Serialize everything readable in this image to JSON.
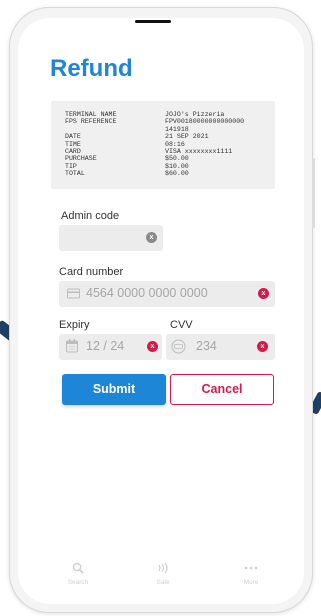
{
  "screen": {
    "title": "Refund"
  },
  "receipt": {
    "labels": "TERMINAL NAME\nFPS REFERENCE\n\nDATE\nTIME\nCARD\nPURCHASE\nTIP\nTOTAL",
    "values": "JOJO's Pizzeria\nFPV00180000000000000\n141918\n21 SEP 2021\n08:16\nVISA xxxxxxxx1111\n$50.00\n$10.00\n$60.00"
  },
  "admin_code": {
    "label": "Admin code",
    "value": ""
  },
  "card_number": {
    "label": "Card number",
    "value": "4564 0000 0000 0000",
    "icon": "credit-card-icon"
  },
  "expiry": {
    "label": "Expiry",
    "value": "12 / 24",
    "icon": "calendar-icon"
  },
  "cvv": {
    "label": "CVV",
    "value": "234",
    "icon": "cvv-icon"
  },
  "clear_glyph": "x",
  "buttons": {
    "submit": "Submit",
    "cancel": "Cancel"
  },
  "nav": [
    {
      "label": "Search",
      "icon": "search-icon"
    },
    {
      "label": "Sale",
      "icon": "contactless-icon"
    },
    {
      "label": "More",
      "icon": "more-icon"
    }
  ],
  "colors": {
    "primary": "#1e86d6",
    "danger": "#d71a4b",
    "field": "#ececec"
  }
}
